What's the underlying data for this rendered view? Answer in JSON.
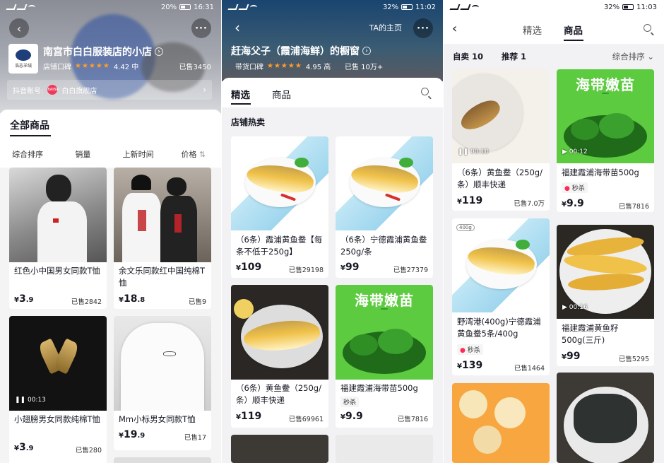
{
  "colors": {
    "accent": "#fe2c55",
    "star": "#ff9c2a"
  },
  "panel1": {
    "status": {
      "battery": "20%",
      "time": "16:31"
    },
    "shop": {
      "name": "南宫市白白服装店的小店",
      "logo_text": "浩志羊绒",
      "rating_label": "店铺口碑",
      "rating_value": "4.42 中",
      "sold": "已售3450",
      "stars": "★★★★★"
    },
    "account": {
      "label": "抖音账号:",
      "badge": "BAIBAI",
      "name": "白白旗舰店"
    },
    "tab": "全部商品",
    "sort": [
      "综合排序",
      "销量",
      "上新时间",
      "价格"
    ],
    "products": [
      {
        "name": "红色小中国男女同款T恤",
        "currency": "¥",
        "price_int": "3",
        "price_dec": ".9",
        "sold": "已售2842"
      },
      {
        "name": "余文乐同款红中国纯棉T恤",
        "currency": "¥",
        "price_int": "18",
        "price_dec": ".8",
        "sold": "已售9"
      },
      {
        "name": "小翅膀男女同款纯棉T恤",
        "currency": "¥",
        "price_int": "3",
        "price_dec": ".9",
        "sold": "已售280",
        "video": "00:13"
      },
      {
        "name": "Mm小标男女同款T恤",
        "currency": "¥",
        "price_int": "19",
        "price_dec": ".9",
        "sold": "已售17"
      }
    ]
  },
  "panel2": {
    "status": {
      "battery": "32%",
      "time": "11:02"
    },
    "home": "TA的主页",
    "title": "赶海父子（霞浦海鲜）的橱窗",
    "rating_label": "带货口碑",
    "rating_value": "4.95 高",
    "sold": "已售 10万+",
    "stars": "★★★★★",
    "tabs": [
      "精选",
      "商品"
    ],
    "section": "店铺热卖",
    "products": [
      {
        "name": "（6条）霞浦黄鱼鲞【每条不低于250g】",
        "currency": "¥",
        "price": "109",
        "sold": "已售29198"
      },
      {
        "name": "（6条）宁德霞浦黄鱼鲞250g/条",
        "currency": "¥",
        "price": "99",
        "sold": "已售27379"
      },
      {
        "name": "（6条）黄鱼鲞（250g/条）顺丰快递",
        "currency": "¥",
        "price": "119",
        "sold": "已售69961"
      },
      {
        "name": "福建霞浦海带苗500g",
        "currency": "¥",
        "price": "9.9",
        "sold": "已售7816",
        "tag": "秒杀"
      }
    ],
    "seaweed_title": "海带嫩苗"
  },
  "panel3": {
    "status": {
      "battery": "32%",
      "time": "11:03"
    },
    "tabs": [
      "精选",
      "商品"
    ],
    "filter": {
      "self": "自卖 10",
      "recommend": "推荐 1",
      "sort": "综合排序"
    },
    "products": [
      {
        "name": "（6条）黄鱼鲞（250g/条）顺丰快递",
        "currency": "¥",
        "price": "119",
        "sold": "已售7.0万",
        "video": "00:10"
      },
      {
        "name": "福建霞浦海带苗500g",
        "currency": "¥",
        "price": "9.9",
        "sold": "已售7816",
        "video": "00:12",
        "tag": "秒杀"
      },
      {
        "name": "野湾港(400g)宁德霞浦黄鱼鲞5条/400g",
        "currency": "¥",
        "price": "139",
        "sold": "已售1464",
        "tag": "秒杀",
        "badge": "400g"
      },
      {
        "name": "福建霞浦黄鱼籽500g(三斤)",
        "currency": "¥",
        "price": "99",
        "sold": "已售5295",
        "video": "00:16"
      }
    ],
    "seaweed_title": "海带嫩苗"
  }
}
